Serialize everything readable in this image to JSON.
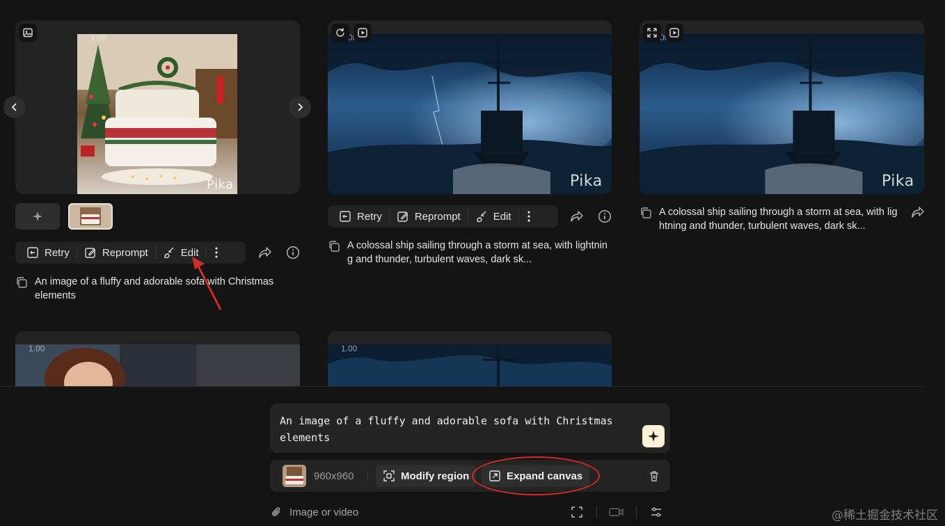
{
  "cards": [
    {
      "version": "1.00",
      "watermark": "Pika"
    },
    {
      "version": "1.00",
      "watermark": "Pika"
    },
    {
      "version": "1.00",
      "watermark": "Pika"
    },
    {
      "version": "1.00"
    },
    {
      "version": "1.00"
    }
  ],
  "toolbar": {
    "retry": "Retry",
    "reprompt": "Reprompt",
    "edit": "Edit"
  },
  "captions": {
    "card1": "An image of a fluffy and adorable sofa with Christmas elements",
    "card2": "A colossal ship sailing through a storm at sea, with lightning and thunder, turbulent waves, dark sk...",
    "card3": "A colossal ship sailing through a storm at sea, with lightning and thunder, turbulent waves, dark sk..."
  },
  "prompt": {
    "text": "An image of a fluffy and adorable sofa with Christmas elements"
  },
  "options": {
    "resolution": "960x960",
    "modify_region": "Modify region",
    "expand_canvas": "Expand canvas"
  },
  "bottom": {
    "attach_label": "Image or video"
  },
  "site_watermark": "@稀土掘金技术社区",
  "colors": {
    "background": "#141414",
    "card": "#232323",
    "accent_generate": "#fdf1d8",
    "annotation_red": "#d42a2a"
  }
}
